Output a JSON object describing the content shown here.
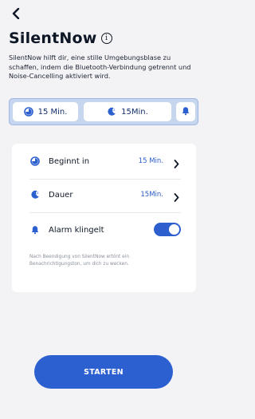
{
  "header": {
    "title": "SilentNow",
    "description": "SilentNow hilft dir, eine stille Umgebungsblase zu schaffen, indem die Bluetooth-Verbindung getrennt und Noise-Cancelling aktiviert wird."
  },
  "summary": {
    "start_label": "15 Min.",
    "duration_label": "15Min."
  },
  "settings": {
    "starts_in": {
      "label": "Beginnt in",
      "value": "15 Min."
    },
    "duration": {
      "label": "Dauer",
      "value": "15Min."
    },
    "alarm": {
      "label": "Alarm klingelt",
      "enabled": true
    },
    "note": "Nach Beendigung von SilentNow ertönt ein Benachrichtigungston, um dich zu wecken."
  },
  "actions": {
    "start_label": "STARTEN"
  },
  "colors": {
    "accent": "#2c5fd0",
    "strip": "#c7d6ef",
    "background": "#f3f3f5"
  }
}
